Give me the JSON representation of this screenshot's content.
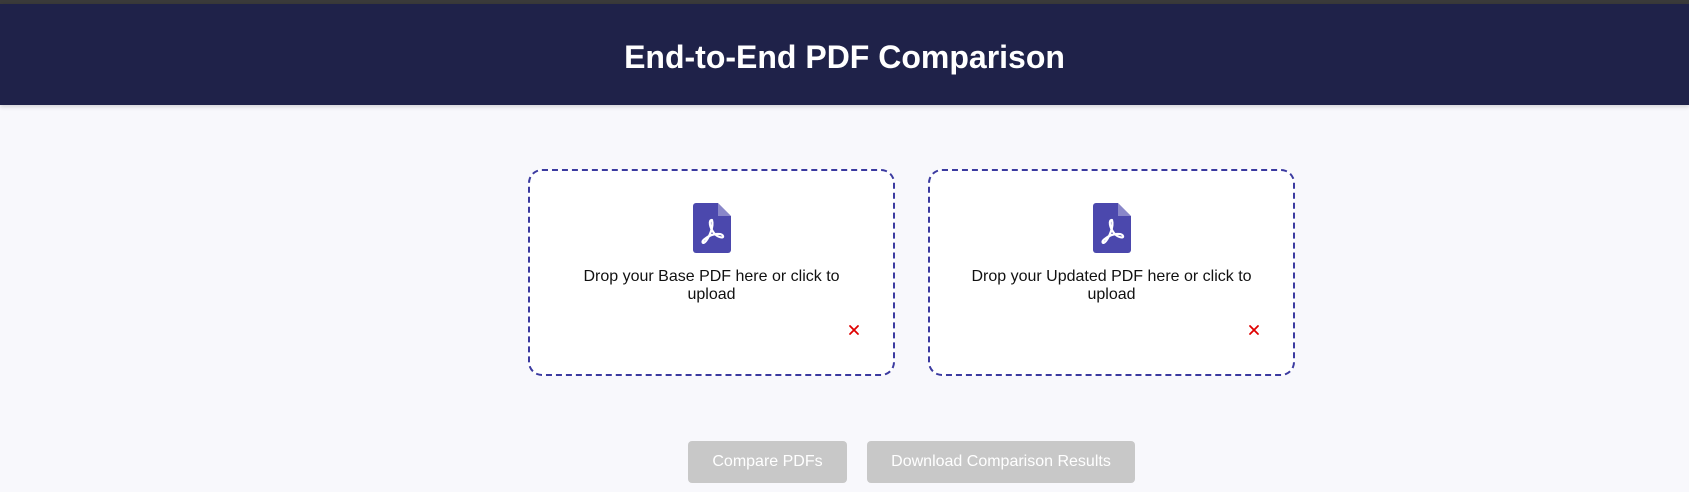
{
  "header": {
    "title": "End-to-End PDF Comparison",
    "background": "#1f2249"
  },
  "dropzones": [
    {
      "label": "Drop your Base PDF here or click to upload",
      "icon": "pdf-file-icon",
      "remove_icon": "close-icon"
    },
    {
      "label": "Drop your Updated PDF here or click to upload",
      "icon": "pdf-file-icon",
      "remove_icon": "close-icon"
    }
  ],
  "actions": {
    "compare_label": "Compare PDFs",
    "download_label": "Download Comparison Results",
    "disabled_color": "#c8c8c8"
  },
  "colors": {
    "accent": "#3b3aa0",
    "icon": "#4b48ad",
    "remove": "#e00000"
  }
}
